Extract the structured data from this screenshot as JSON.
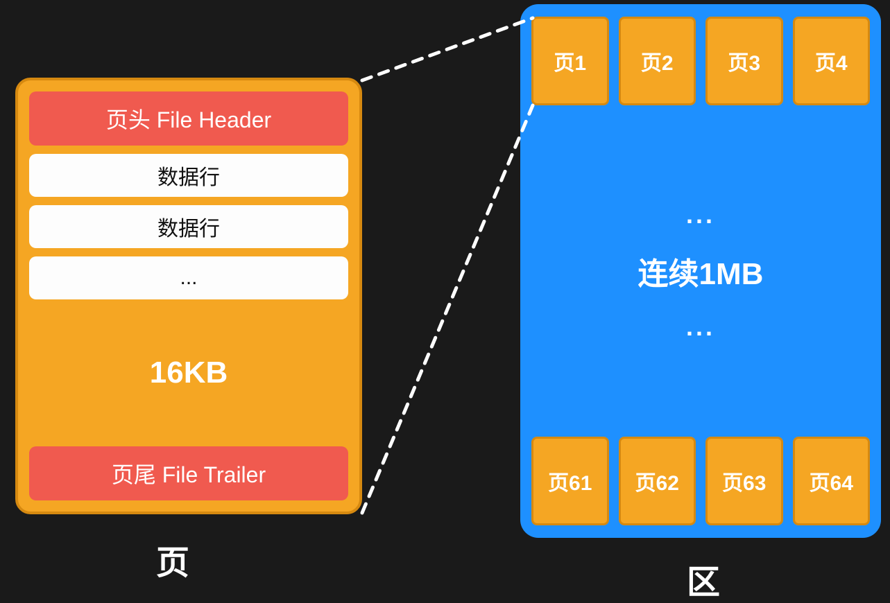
{
  "page": {
    "header": "页头 File Header",
    "rows": [
      "数据行",
      "数据行",
      "..."
    ],
    "size": "16KB",
    "trailer": "页尾 File Trailer",
    "label": "页"
  },
  "extent": {
    "top_pages": [
      "页1",
      "页2",
      "页3",
      "页4"
    ],
    "center_dots": "...",
    "center_label": "连续1MB",
    "bottom_pages": [
      "页61",
      "页62",
      "页63",
      "页64"
    ],
    "label": "区"
  },
  "colors": {
    "background": "#1a1a1a",
    "page_bg": "#f5a623",
    "page_border": "#d68910",
    "header_trailer": "#f05a4f",
    "row_bg": "#fdfdfd",
    "extent_bg": "#1e90ff"
  }
}
